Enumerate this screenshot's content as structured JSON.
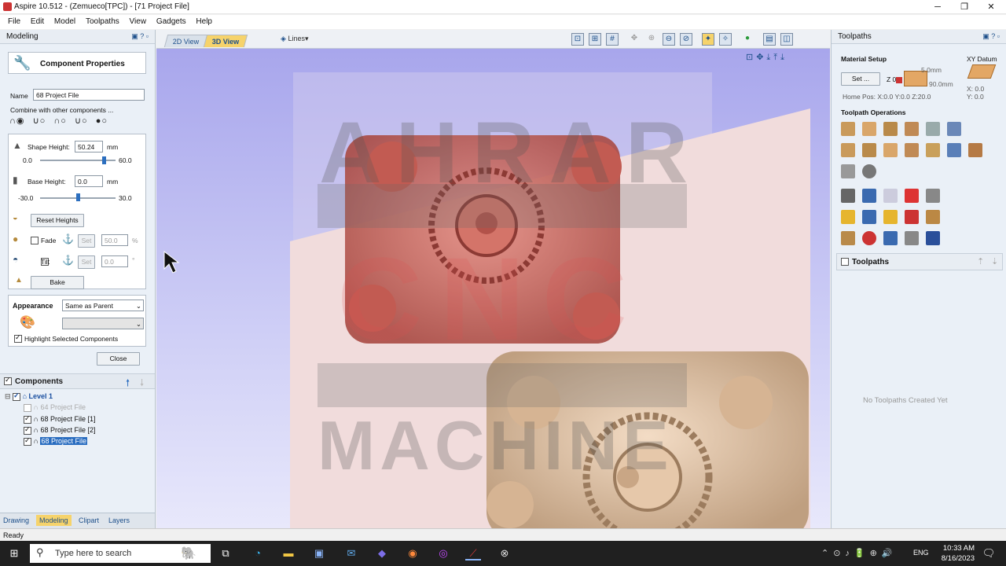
{
  "window": {
    "title": "Aspire 10.512 - (Zemueco[TPC]) - [71 Project File]",
    "minimize": "─",
    "maximize": "❐",
    "close": "✕"
  },
  "menu": [
    "File",
    "Edit",
    "Model",
    "Toolpaths",
    "View",
    "Gadgets",
    "Help"
  ],
  "left": {
    "header": "Modeling",
    "component_properties": {
      "title": "Component Properties",
      "name_label": "Name",
      "name_value": "68 Project File",
      "combine_label": "Combine with other components ...",
      "shape_height_label": "Shape Height:",
      "shape_height_value": "50.24",
      "shape_height_unit": "mm",
      "shape_height_min": "0.0",
      "shape_height_max": "60.0",
      "shape_height_level": 0.84,
      "base_height_label": "Base Height:",
      "base_height_value": "0.0",
      "base_height_unit": "mm",
      "base_height_min": "-30.0",
      "base_height_max": "30.0",
      "base_height_level": 0.5,
      "reset_heights": "Reset Heights",
      "fade_label": "Fade",
      "fade_set": "Set",
      "fade_value": "50.0",
      "fade_unit": "%",
      "tilt_label": "Tilt",
      "tilt_set": "Set",
      "tilt_value": "0.0",
      "tilt_unit": "°",
      "bake": "Bake",
      "appearance_label": "Appearance",
      "appearance_value": "Same as Parent",
      "highlight_label": "Highlight Selected Components",
      "close": "Close"
    },
    "components": {
      "header": "Components",
      "tree": [
        {
          "label": "Level 1",
          "checked": true
        },
        {
          "label": "64 Project File",
          "checked": false
        },
        {
          "label": "68 Project File [1]",
          "checked": true
        },
        {
          "label": "68 Project File [2]",
          "checked": true
        },
        {
          "label": "68 Project File",
          "checked": true
        }
      ]
    },
    "bottom_tabs": [
      "Drawing",
      "Modeling",
      "Clipart",
      "Layers"
    ]
  },
  "viewport": {
    "tabs": [
      "2D View",
      "3D View"
    ],
    "lines_dropdown": "Lines",
    "watermark_top": "AHRAR",
    "watermark_mid": "CNC",
    "watermark_bottom": "MACHINE",
    "colors": {
      "piece1": "#c8625a",
      "piece2": "#e2c6a8",
      "board": "#f1dcdc"
    }
  },
  "right": {
    "header": "Toolpaths",
    "material_setup": "Material Setup",
    "set_button": "Set ...",
    "xy_datum": "XY Datum",
    "z_label": "Z 0",
    "dim_top": "5.0mm",
    "dim_bottom": "90.0mm",
    "home_pos": "Home Pos:  X:0.0 Y:0.0 Z:20.0",
    "x_val": "X: 0.0",
    "y_val": "Y: 0.0",
    "toolpath_operations": "Toolpath Operations",
    "toolpaths_label": "Toolpaths",
    "no_toolpaths": "No Toolpaths Created Yet"
  },
  "status": "Ready",
  "taskbar": {
    "search_placeholder": "Type here to search",
    "lang": "ENG",
    "time": "10:33 AM",
    "date": "8/16/2023"
  }
}
